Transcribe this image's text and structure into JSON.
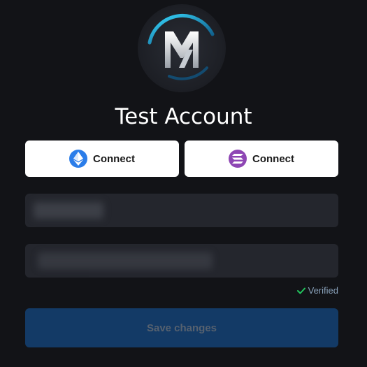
{
  "profile": {
    "account_name": "Test Account",
    "avatar_icon": "brand-logo-icon"
  },
  "wallets": {
    "ethereum": {
      "label": "Connect",
      "icon": "ethereum-icon",
      "icon_color": "#2b7de9"
    },
    "solana": {
      "label": "Connect",
      "icon": "solana-icon",
      "icon_color": "#8e46b4"
    }
  },
  "form": {
    "verified_label": "Verified",
    "verified_icon": "check-icon",
    "verified_color": "#22c55e",
    "save_label": "Save changes",
    "save_color": "#133a66"
  }
}
